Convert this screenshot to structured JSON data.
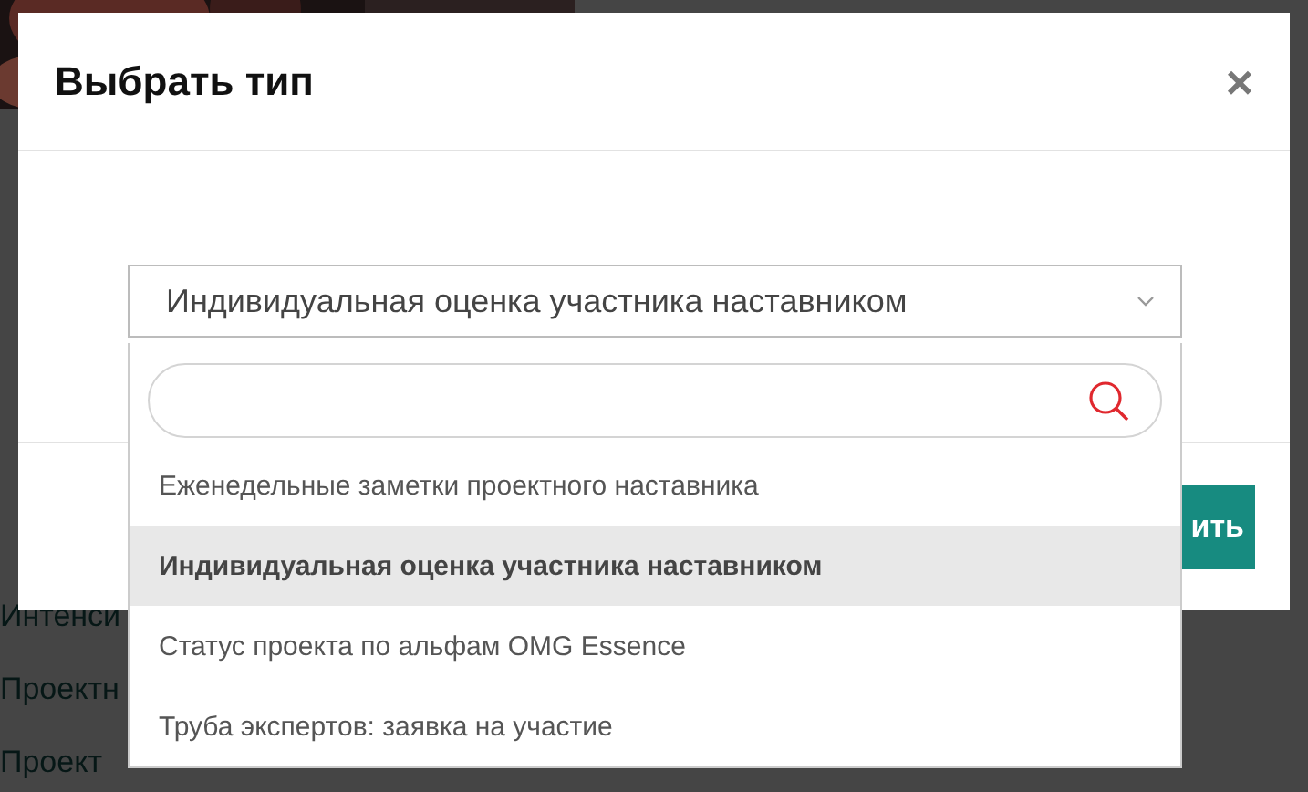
{
  "background": {
    "lines": [
      "Интенси",
      "Проектн",
      "Проект"
    ]
  },
  "dialog": {
    "title": "Выбрать тип",
    "close": "×",
    "select": {
      "value": "Индивидуальная оценка участника наставником",
      "expanded": true
    },
    "options": [
      {
        "label": "Еженедельные заметки проектного наставника",
        "selected": false
      },
      {
        "label": "Индивидуальная оценка участника наставником",
        "selected": true
      },
      {
        "label": "Статус проекта по альфам OMG Essence",
        "selected": false
      },
      {
        "label": "Труба экспертов: заявка на участие",
        "selected": false
      }
    ],
    "button": "ить"
  }
}
